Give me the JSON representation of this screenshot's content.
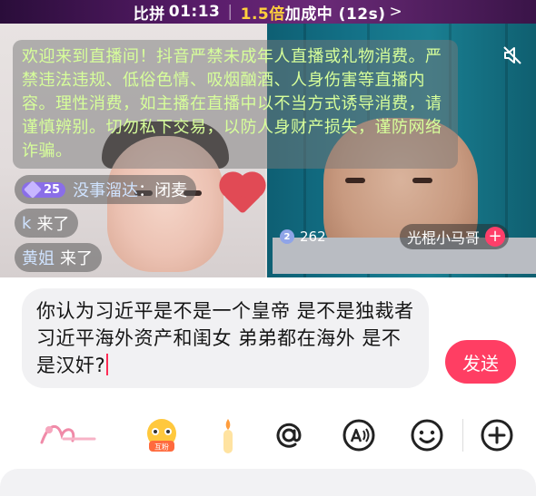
{
  "topbar": {
    "label": "比拼",
    "timer": "01:13",
    "multiplier": "1.5倍",
    "bonus_text": "加成中 (12s)",
    "chevron": ">"
  },
  "notice": {
    "text": "欢迎来到直播间！抖音严禁未成年人直播或礼物消费。严禁违法违规、低俗色情、吸烟酗酒、人身伤害等直播内容。理性消费，如主播在直播中以不当方式诱导消费，请谨慎辨别。切勿私下交易，以防人身财产损失，谨防网络诈骗。"
  },
  "chat": [
    {
      "level": "25",
      "name": "没事溜达",
      "message": "：闭麦"
    },
    {
      "name": "k",
      "message": "来了"
    },
    {
      "name": "黄姐",
      "message": "来了"
    }
  ],
  "video": {
    "viewer_count": "262",
    "viewer_badge": "2",
    "anchor_name": "光棍小马哥",
    "plus_symbol": "+"
  },
  "input": {
    "text": "你认为习近平是不是一个皇帝  是不是独裁者  习近平海外资产和闺女 弟弟都在海外 是不是汉奸?"
  },
  "send_button": {
    "label": "发送"
  },
  "toolbar": {
    "icons": [
      "brand-sticker-icon",
      "fan-club-emoji-icon",
      "candle-icon",
      "at-mention-icon",
      "voice-text-icon",
      "emoji-icon",
      "more-plus-icon"
    ],
    "fan_badge_text": "互粉"
  },
  "colors": {
    "accent": "#ff3e63",
    "notice_text": "#d7ff9a",
    "topbar_highlight": "#ffcf3d"
  }
}
